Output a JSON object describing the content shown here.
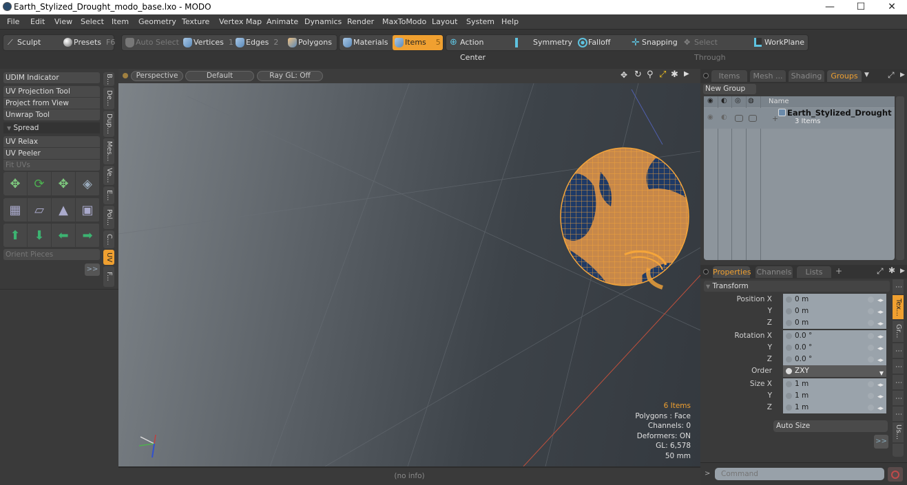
{
  "window": {
    "title": "Earth_Stylized_Drought_modo_base.lxo - MODO",
    "controls": {
      "minimize": "—",
      "maximize": "☐",
      "close": "✕"
    }
  },
  "menu": [
    "File",
    "Edit",
    "View",
    "Select",
    "Item",
    "Geometry",
    "Texture",
    "Vertex Map",
    "Animate",
    "Dynamics",
    "Render",
    "MaxToModo",
    "Layout",
    "System",
    "Help"
  ],
  "toolbar": {
    "sculpt": "Sculpt",
    "presets": "Presets",
    "presets_key": "F6",
    "auto_select": "Auto Select",
    "vertices": "Vertices",
    "vertices_key": "1",
    "edges": "Edges",
    "edges_key": "2",
    "polygons": "Polygons",
    "materials": "Materials",
    "items": "Items",
    "items_key": "5",
    "action_center": "Action Center",
    "symmetry": "Symmetry",
    "falloff": "Falloff",
    "snapping": "Snapping",
    "select_through": "Select Through",
    "workplane": "WorkPlane"
  },
  "left_panel": {
    "buttons": [
      "UDIM Indicator",
      "UV Projection Tool",
      "Project from View",
      "Unwrap Tool"
    ],
    "section": "Spread",
    "buttons2": [
      "UV Relax",
      "UV Peeler",
      "Fit UVs"
    ],
    "orient_pieces": "Orient Pieces",
    "more": ">>",
    "side_tabs": [
      "B...",
      "De...",
      "Dup...",
      "Mes...",
      "Ve...",
      "E...",
      "Pol...",
      "C...",
      "UV",
      "F..."
    ]
  },
  "viewport": {
    "view": "Perspective",
    "shading": "Default",
    "raygl": "Ray GL: Off",
    "info": {
      "items": "6 Items",
      "polygons": "Polygons : Face",
      "channels": "Channels: 0",
      "deformers": "Deformers: ON",
      "gl": "GL: 6,578",
      "size": "50 mm"
    },
    "status": "(no info)"
  },
  "scene_panel": {
    "tabs": [
      "Items",
      "Mesh ...",
      "Shading",
      "Groups"
    ],
    "active_tab": "Groups",
    "new_group": "New Group",
    "column_name": "Name",
    "group": {
      "name": "Earth_Stylized_Drought",
      "count": "3 Items"
    }
  },
  "properties_panel": {
    "tabs": [
      "Properties",
      "Channels",
      "Lists",
      "+"
    ],
    "section": "Transform",
    "rows": [
      {
        "label": "Position X",
        "value": "0 m"
      },
      {
        "label": "Y",
        "value": "0 m"
      },
      {
        "label": "Z",
        "value": "0 m"
      },
      {
        "label": "Rotation X",
        "value": "0.0 °"
      },
      {
        "label": "Y",
        "value": "0.0 °"
      },
      {
        "label": "Z",
        "value": "0.0 °"
      },
      {
        "label": "Order",
        "value": "ZXY"
      },
      {
        "label": "Size X",
        "value": "1 m"
      },
      {
        "label": "Y",
        "value": "1 m"
      },
      {
        "label": "Z",
        "value": "1 m"
      }
    ],
    "auto_size": "Auto Size",
    "more": ">>",
    "side_tabs": [
      "Tex...",
      "Gr...",
      "Us..."
    ]
  },
  "command": {
    "prompt": ">",
    "placeholder": "Command"
  },
  "colors": {
    "accent": "#f0a030",
    "wire": "#f5a53a",
    "ocean": "#1f3a66"
  }
}
